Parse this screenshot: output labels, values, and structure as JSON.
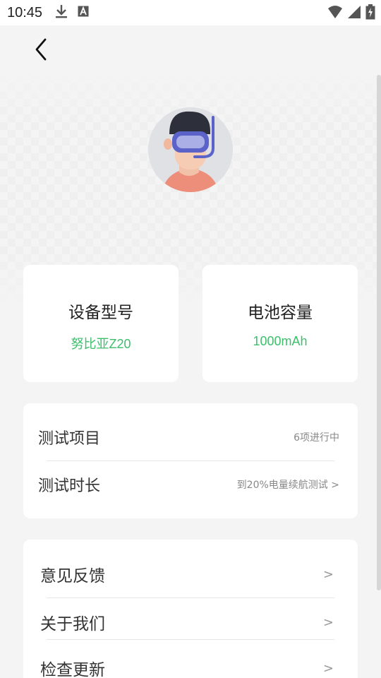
{
  "status": {
    "time": "10:45"
  },
  "device": {
    "model_label": "设备型号",
    "model_value": "努比亚Z20",
    "battery_label": "电池容量",
    "battery_value": "1000mAh"
  },
  "tests": {
    "items_label": "测试项目",
    "items_value": "6项进行中",
    "duration_label": "测试时长",
    "duration_value": "到20%电量续航测试 >"
  },
  "menu": {
    "items": [
      {
        "label": "意见反馈",
        "chevron": ">"
      },
      {
        "label": "关于我们",
        "chevron": ">"
      },
      {
        "label": "检查更新",
        "chevron": ">"
      }
    ]
  },
  "colors": {
    "accent": "#3cbf6b",
    "background": "#f4f4f4",
    "card": "#ffffff"
  },
  "icons": [
    "download-icon",
    "keyboard-a-icon",
    "wifi-icon",
    "signal-icon",
    "battery-charging-icon",
    "back-chevron-icon",
    "avatar-diver-icon"
  ]
}
